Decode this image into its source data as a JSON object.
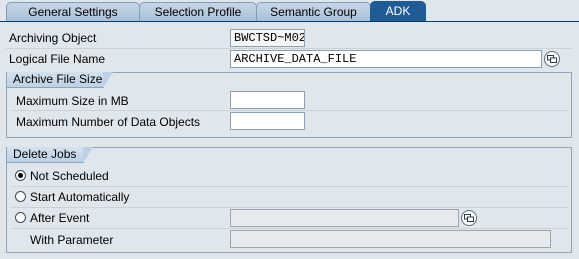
{
  "tabs": [
    {
      "label": "General Settings",
      "active": false
    },
    {
      "label": "Selection Profile",
      "active": false
    },
    {
      "label": "Semantic Group",
      "active": false
    },
    {
      "label": "ADK",
      "active": true
    }
  ],
  "archiving_object": {
    "label": "Archiving Object",
    "value": "BWCTSD~M02"
  },
  "logical_file": {
    "label": "Logical File Name",
    "value": "ARCHIVE_DATA_FILE",
    "icon": "value-help-icon"
  },
  "archive_file_size": {
    "title": "Archive File Size",
    "max_size": {
      "label": "Maximum Size in MB",
      "value": ""
    },
    "max_objects": {
      "label": "Maximum Number of Data Objects",
      "value": ""
    }
  },
  "delete_jobs": {
    "title": "Delete Jobs",
    "options": [
      {
        "label": "Not Scheduled",
        "selected": true
      },
      {
        "label": "Start Automatically",
        "selected": false
      },
      {
        "label": "After Event",
        "selected": false
      }
    ],
    "after_event_value": "",
    "with_parameter": {
      "label": "With Parameter",
      "value": ""
    }
  }
}
